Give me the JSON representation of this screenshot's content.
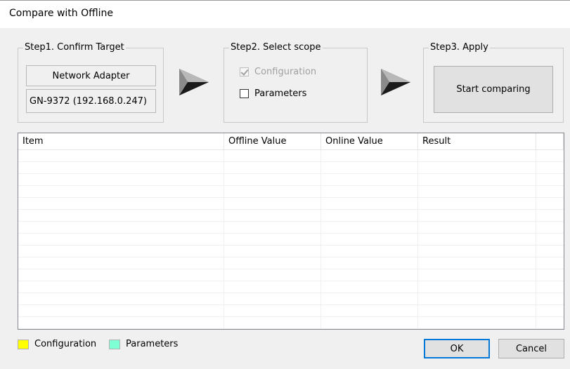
{
  "window": {
    "title": "Compare with Offline"
  },
  "step1": {
    "label": "Step1. Confirm Target",
    "device_type": "Network Adapter",
    "device_name": "GN-9372 (192.168.0.247)"
  },
  "step2": {
    "label": "Step2. Select scope",
    "options": [
      {
        "label": "Configuration",
        "checked": true,
        "enabled": false
      },
      {
        "label": "Parameters",
        "checked": false,
        "enabled": true
      }
    ]
  },
  "step3": {
    "label": "Step3. Apply",
    "start_button": "Start comparing"
  },
  "table": {
    "columns": [
      "Item",
      "Offline Value",
      "Online Value",
      "Result",
      ""
    ],
    "rows": []
  },
  "legend": {
    "items": [
      {
        "label": "Configuration",
        "color": "#ffff00"
      },
      {
        "label": "Parameters",
        "color": "#7fffd4"
      }
    ]
  },
  "buttons": {
    "ok": "OK",
    "cancel": "Cancel"
  }
}
